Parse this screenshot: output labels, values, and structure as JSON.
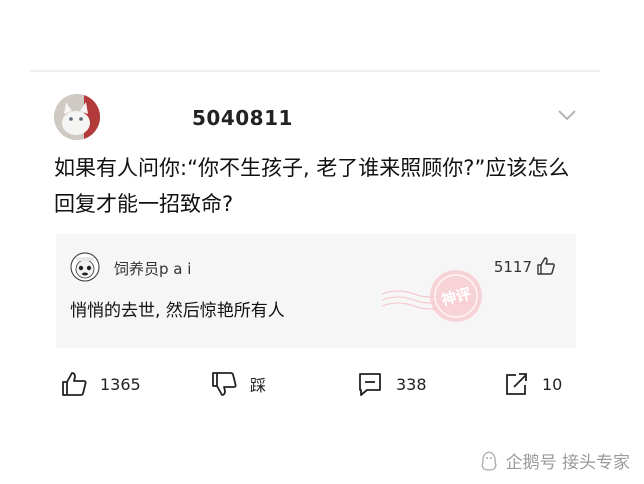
{
  "post": {
    "username": "5040811",
    "question": "如果有人问你:“你不生孩子, 老了谁来照顾你?”应该怎么回复才能一招致命?"
  },
  "reply": {
    "name": "饲养员p a i",
    "likes": "5117",
    "text": "悄悄的去世, 然后惊艳所有人",
    "stamp_text": "神评"
  },
  "actions": {
    "like_count": "1365",
    "dislike_label": "踩",
    "comment_count": "338",
    "share_count": "10"
  },
  "watermark": {
    "text": "企鹅号 接头专家"
  },
  "colors": {
    "stamp": "#f07a86",
    "reply_bg": "#f6f6f6"
  }
}
